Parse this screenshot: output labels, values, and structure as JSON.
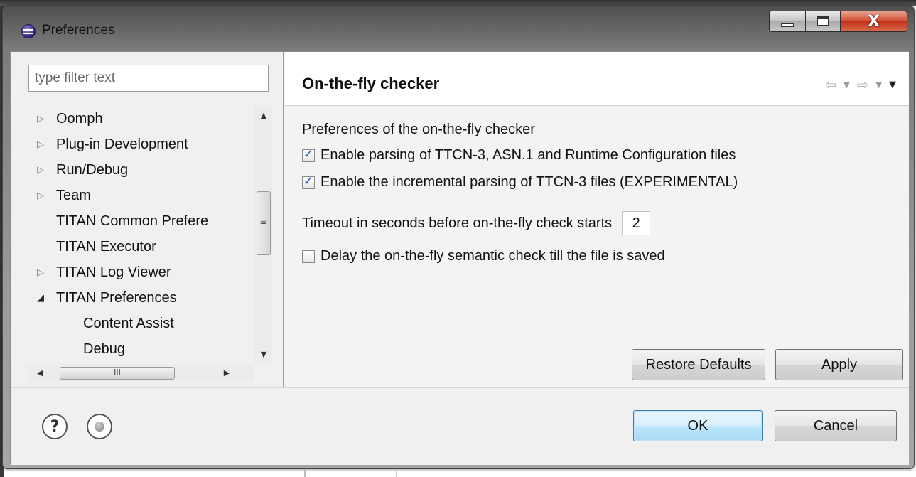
{
  "window": {
    "title": "Preferences",
    "close_glyph": "X"
  },
  "filter": {
    "placeholder": "type filter text",
    "value": ""
  },
  "tree": {
    "items": [
      {
        "label": "Oomph",
        "arrow": "▷"
      },
      {
        "label": "Plug-in Development",
        "arrow": "▷"
      },
      {
        "label": "Run/Debug",
        "arrow": "▷"
      },
      {
        "label": "Team",
        "arrow": "▷"
      },
      {
        "label": "TITAN Common Prefere",
        "arrow": ""
      },
      {
        "label": "TITAN Executor",
        "arrow": ""
      },
      {
        "label": "TITAN Log Viewer",
        "arrow": "▷"
      },
      {
        "label": "TITAN Preferences",
        "arrow": "◢"
      },
      {
        "label": "Content Assist",
        "arrow": ""
      },
      {
        "label": "Debug",
        "arrow": ""
      }
    ],
    "vscroll_thumb_glyph": "≡",
    "hscroll_thumb_glyph": "III"
  },
  "page": {
    "title": "On-the-fly checker",
    "section_label": "Preferences of the on-the-fly checker",
    "options": [
      {
        "label": "Enable parsing of TTCN-3, ASN.1 and Runtime Configuration files",
        "checked": true
      },
      {
        "label": "Enable the incremental parsing of TTCN-3 files (EXPERIMENTAL)",
        "checked": true
      },
      {
        "label": "Delay the on-the-fly semantic check till the file is saved",
        "checked": false
      }
    ],
    "timeout_label": "Timeout in seconds before on-the-fly check starts",
    "timeout_value": "2",
    "restore_defaults_label": "Restore Defaults",
    "apply_label": "Apply"
  },
  "nav": {
    "back_glyph": "⇦",
    "forward_glyph": "⇨",
    "dropdown_glyph": "▼"
  },
  "footer": {
    "help_glyph": "?",
    "ok_label": "OK",
    "cancel_label": "Cancel"
  },
  "colors": {
    "ok_button_accent": "#3c7fb1",
    "check_mark": "#1d58b0",
    "close_button": "#c0301a"
  }
}
